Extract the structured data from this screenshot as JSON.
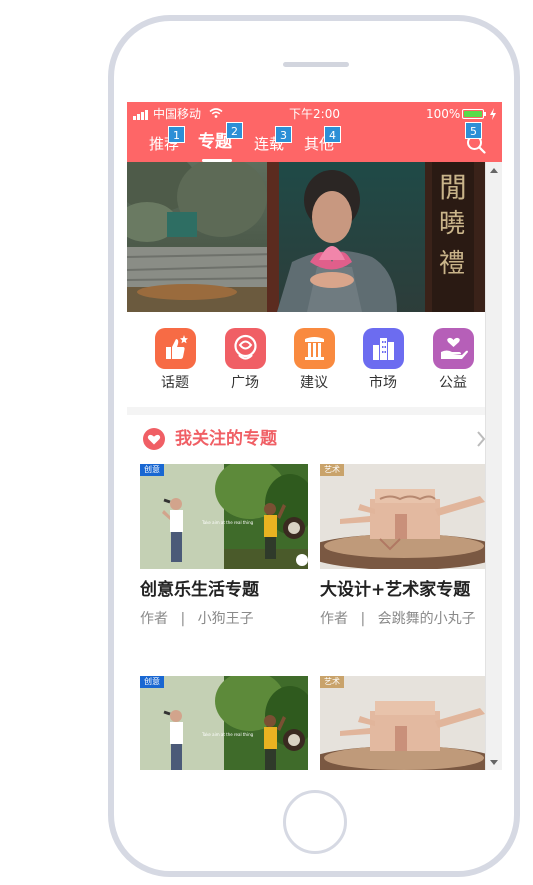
{
  "status_bar": {
    "carrier": "中国移动",
    "time": "下午2:00",
    "battery": "100%"
  },
  "nav": {
    "tabs": [
      {
        "label": "推荐",
        "badge": "1"
      },
      {
        "label": "专题",
        "badge": "2"
      },
      {
        "label": "连载",
        "badge": "3"
      },
      {
        "label": "其他",
        "badge": "4"
      }
    ],
    "active_tab": "专题",
    "search_badge": "5",
    "search_icon": "search-icon"
  },
  "categories": [
    {
      "label": "话题",
      "icon": "thumbs-up-icon",
      "color": "#f76b45"
    },
    {
      "label": "广场",
      "icon": "rose-icon",
      "color": "#f05f65"
    },
    {
      "label": "建议",
      "icon": "pillar-icon",
      "color": "#f98a3f"
    },
    {
      "label": "市场",
      "icon": "buildings-icon",
      "color": "#6c6cf0"
    },
    {
      "label": "公益",
      "icon": "charity-icon",
      "color": "#b65fb8"
    }
  ],
  "section": {
    "title": "我关注的专题"
  },
  "cards": [
    {
      "title": "创意乐生活专题",
      "author_label": "作者",
      "separator": "|",
      "author": "小狗王子",
      "tag": "创意",
      "tag_color": "#1967d2"
    },
    {
      "title": "大设计+艺术家专题",
      "author_label": "作者",
      "separator": "|",
      "author": "会跳舞的小丸子",
      "tag": "艺术",
      "tag_color": "#c9a36b"
    },
    {
      "title": "",
      "author_label": "",
      "separator": "",
      "author": "",
      "tag": "创意",
      "tag_color": "#1967d2"
    },
    {
      "title": "",
      "author_label": "",
      "separator": "",
      "author": "",
      "tag": "艺术",
      "tag_color": "#c9a36b"
    }
  ],
  "colors": {
    "brand": "#fe6667",
    "section_accent": "#f05f65",
    "badge": "#2c8fd6"
  }
}
